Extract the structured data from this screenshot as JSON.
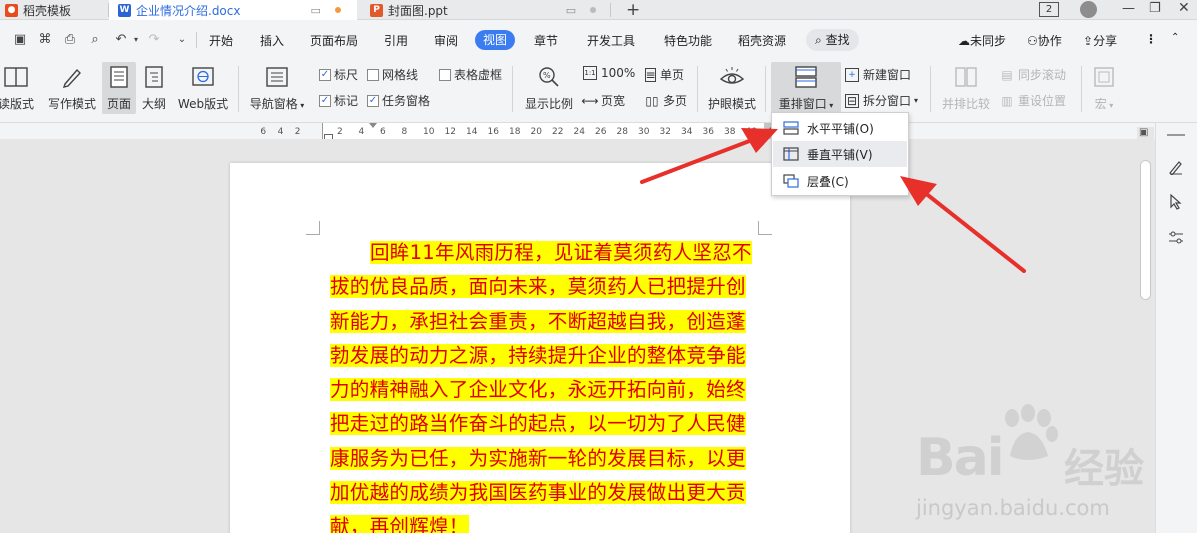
{
  "tabs": [
    {
      "label": "稻壳模板",
      "icon": "wps-logo-icon"
    },
    {
      "label": "企业情况介绍.docx",
      "icon": "word-doc-icon",
      "active": true
    },
    {
      "label": "封面图.ppt",
      "icon": "ppt-doc-icon"
    }
  ],
  "window": {
    "page_badge": "2"
  },
  "menu": {
    "items": [
      "开始",
      "插入",
      "页面布局",
      "引用",
      "审阅",
      "视图",
      "章节",
      "开发工具",
      "特色功能",
      "稻壳资源"
    ],
    "active": "视图",
    "search": "查找",
    "right": [
      "未同步",
      "协作",
      "分享"
    ]
  },
  "ribbon": {
    "read_mode": "读版式",
    "write_mode": "写作模式",
    "page": "页面",
    "outline": "大纲",
    "web": "Web版式",
    "nav_pane": "导航窗格",
    "ruler": "标尺",
    "gridlines": "网格线",
    "table_gridlines": "表格虚框",
    "marks": "标记",
    "task_pane": "任务窗格",
    "zoom": "显示比例",
    "hundred": "100%",
    "single_page": "单页",
    "page_width": "页宽",
    "multi_page": "多页",
    "eye_mode": "护眼模式",
    "arrange": "重排窗口",
    "new_window": "新建窗口",
    "split_window": "拆分窗口",
    "side_by_side": "并排比较",
    "sync_scroll": "同步滚动",
    "reset_pos": "重设位置",
    "macro": "宏"
  },
  "ruler_ticks": [
    "6",
    "4",
    "2",
    "2",
    "4",
    "6",
    "8",
    "10",
    "12",
    "14",
    "16",
    "18",
    "20",
    "22",
    "24",
    "26",
    "28",
    "30",
    "32",
    "34",
    "36",
    "38",
    "40",
    "42"
  ],
  "document": {
    "lines": [
      "回眸11年风雨历程，见证着莫须药人坚忍不",
      "拔的优良品质，面向未来，莫须药人已把提升创",
      "新能力，承担社会重责，不断超越自我，创造蓬",
      "勃发展的动力之源，持续提升企业的整体竞争能",
      "力的精神融入了企业文化，永远开拓向前，始终",
      "把走过的路当作奋斗的起点，以一切为了人民健",
      "康服务为已任，为实施新一轮的发展目标，以更",
      "加优越的成绩为我国医药事业的发展做出更大贡",
      "献，再创辉煌！"
    ],
    "text_color": "#e00000",
    "highlight_color": "#ffff00"
  },
  "dropdown": {
    "items": [
      "水平平铺(O)",
      "垂直平铺(V)",
      "层叠(C)"
    ],
    "hovered": "垂直平铺(V)"
  },
  "watermark": {
    "brand": "Bai",
    "cn": "经验",
    "url": "jingyan.baidu.com"
  },
  "colors": {
    "accent": "#3b7cf0",
    "arrow": "#e8302a"
  }
}
